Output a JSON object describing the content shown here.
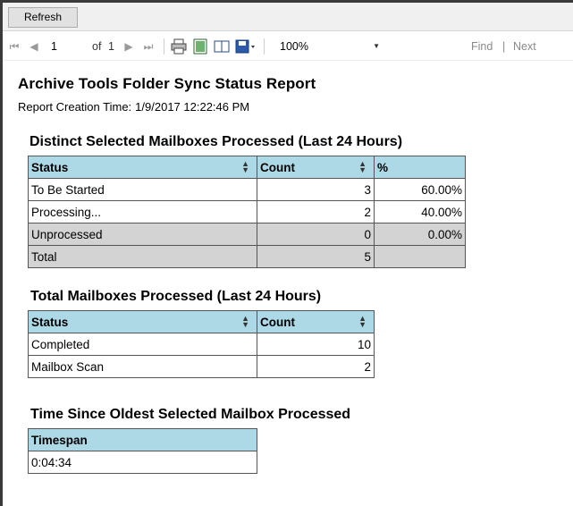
{
  "toolbar": {
    "refresh_label": "Refresh",
    "current_page": "1",
    "of_label": "of",
    "total_pages": "1",
    "zoom": "100%",
    "find_label": "Find",
    "divider": "|",
    "next_label": "Next"
  },
  "report": {
    "title": "Archive Tools Folder Sync Status Report",
    "creation_label": "Report Creation Time:",
    "creation_time": "1/9/2017 12:22:46 PM"
  },
  "distinct": {
    "title": "Distinct Selected Mailboxes Processed (Last 24 Hours)",
    "headers": [
      "Status",
      "Count",
      "%"
    ],
    "rows": [
      [
        "To Be Started",
        "3",
        "60.00%"
      ],
      [
        "Processing...",
        "2",
        "40.00%"
      ],
      [
        "Unprocessed",
        "0",
        "0.00%"
      ],
      [
        "Total",
        "5",
        ""
      ]
    ]
  },
  "total": {
    "title": "Total Mailboxes Processed (Last 24 Hours)",
    "headers": [
      "Status",
      "Count"
    ],
    "rows": [
      [
        "Completed",
        "10"
      ],
      [
        "Mailbox Scan",
        "2"
      ]
    ]
  },
  "oldest": {
    "title": "Time Since Oldest Selected Mailbox Processed",
    "header": "Timespan",
    "value": "0:04:34"
  },
  "colors": {
    "header_bg": "#add8e6",
    "grey_row_bg": "#d3d3d3"
  }
}
